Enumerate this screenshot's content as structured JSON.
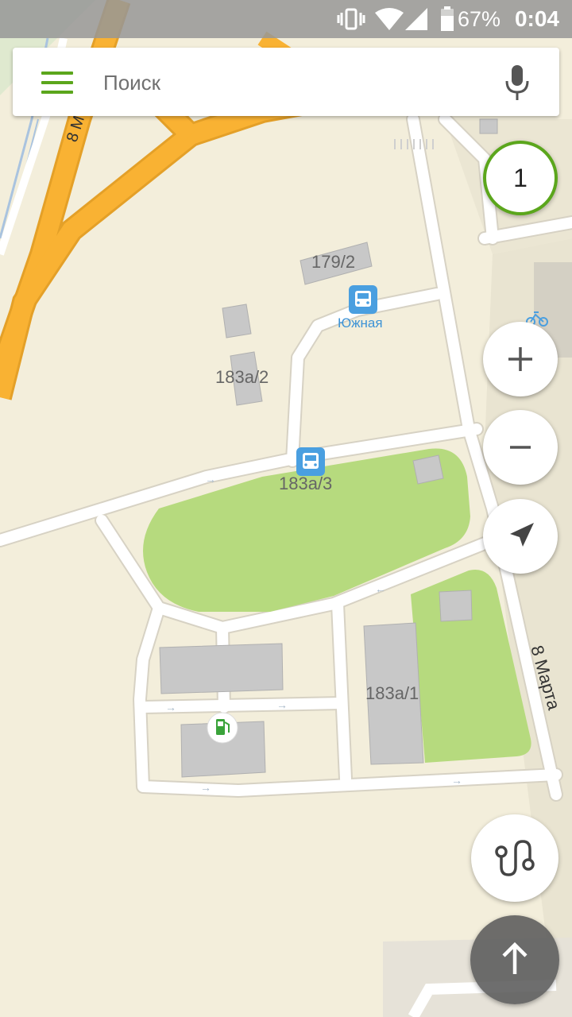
{
  "status_bar": {
    "battery": "67%",
    "time": "0:04"
  },
  "search": {
    "placeholder": "Поиск"
  },
  "traffic_level": "1",
  "map_labels": {
    "street_8marta_top": "8 М",
    "street_8marta": "8 Марта",
    "building_179_2": "179/2",
    "stop_yuzhnaya": "Южная",
    "building_183a_2": "183а/2",
    "building_183a_3": "183а/3",
    "building_183a_1": "183а/1"
  },
  "icons": {
    "menu": "hamburger-menu-icon",
    "mic": "microphone-icon",
    "bus_stop": "bus-stop-icon",
    "gas_station": "gas-station-icon",
    "zoom_in": "plus-icon",
    "zoom_out": "minus-icon",
    "location": "navigation-arrow-icon",
    "route": "route-icon",
    "up": "arrow-up-icon",
    "bicycle": "bicycle-icon"
  },
  "colors": {
    "accent": "#5ba61c",
    "road_major": "#f9b233",
    "park": "#b6da7e",
    "bus_stop": "#4a9fe0",
    "land": "#f3eedb",
    "building": "#c8c8c8"
  }
}
